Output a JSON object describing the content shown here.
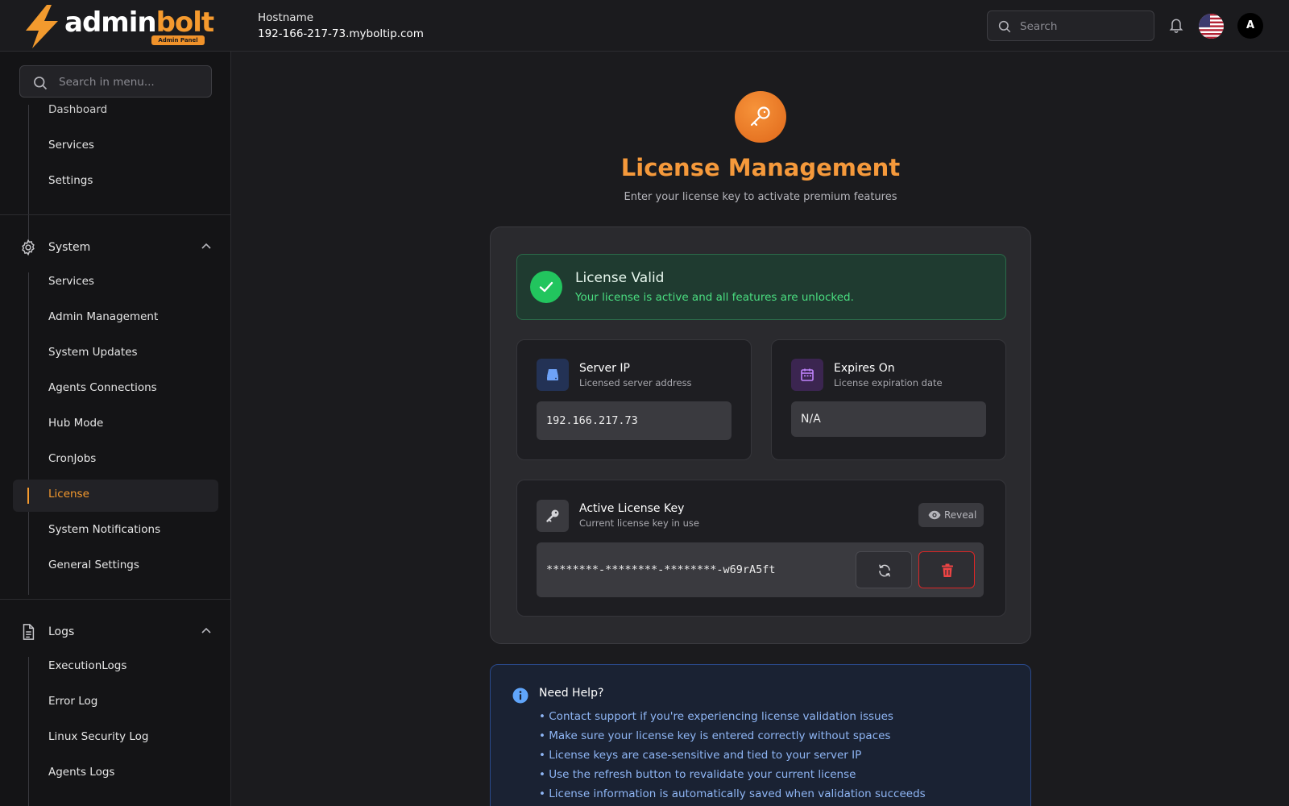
{
  "header": {
    "logo": {
      "admin": "admin",
      "bolt": "bolt",
      "badge": "Admin Panel"
    },
    "hostname_label": "Hostname",
    "hostname_value": "192-166-217-73.myboltip.com",
    "search_placeholder": "Search",
    "avatar_initial": "A",
    "flag": "us-flag-icon"
  },
  "sidebar": {
    "search_placeholder": "Search in menu...",
    "top_items": [
      "Dashboard",
      "Services",
      "Settings"
    ],
    "sections": [
      {
        "label": "System",
        "icon": "gear-icon",
        "items": [
          "Services",
          "Admin Management",
          "System Updates",
          "Agents Connections",
          "Hub Mode",
          "CronJobs",
          "License",
          "System Notifications",
          "General Settings"
        ],
        "active": "License"
      },
      {
        "label": "Logs",
        "icon": "file-icon",
        "items": [
          "ExecutionLogs",
          "Error Log",
          "Linux Security Log",
          "Agents Logs"
        ]
      }
    ]
  },
  "main": {
    "title": "License Management",
    "subtitle": "Enter your license key to activate premium features",
    "status": {
      "title": "License Valid",
      "message": "Your license is active and all features are unlocked."
    },
    "server_ip": {
      "title": "Server IP",
      "subtitle": "Licensed server address",
      "value": "192.166.217.73"
    },
    "expires": {
      "title": "Expires On",
      "subtitle": "License expiration date",
      "value": "N/A"
    },
    "license_key": {
      "title": "Active License Key",
      "subtitle": "Current license key in use",
      "reveal_label": "Reveal",
      "masked_value": "********-********-********-w69rA5ft"
    },
    "help": {
      "title": "Need Help?",
      "items": [
        "• Contact support if you're experiencing license validation issues",
        "• Make sure your license key is entered correctly without spaces",
        "• License keys are case-sensitive and tied to your server IP",
        "• Use the refresh button to revalidate your current license",
        "• License information is automatically saved when validation succeeds"
      ]
    }
  },
  "colors": {
    "accent": "#f59a2e",
    "success": "#22c55e",
    "danger": "#dc2626",
    "info": "#60a5fa"
  }
}
